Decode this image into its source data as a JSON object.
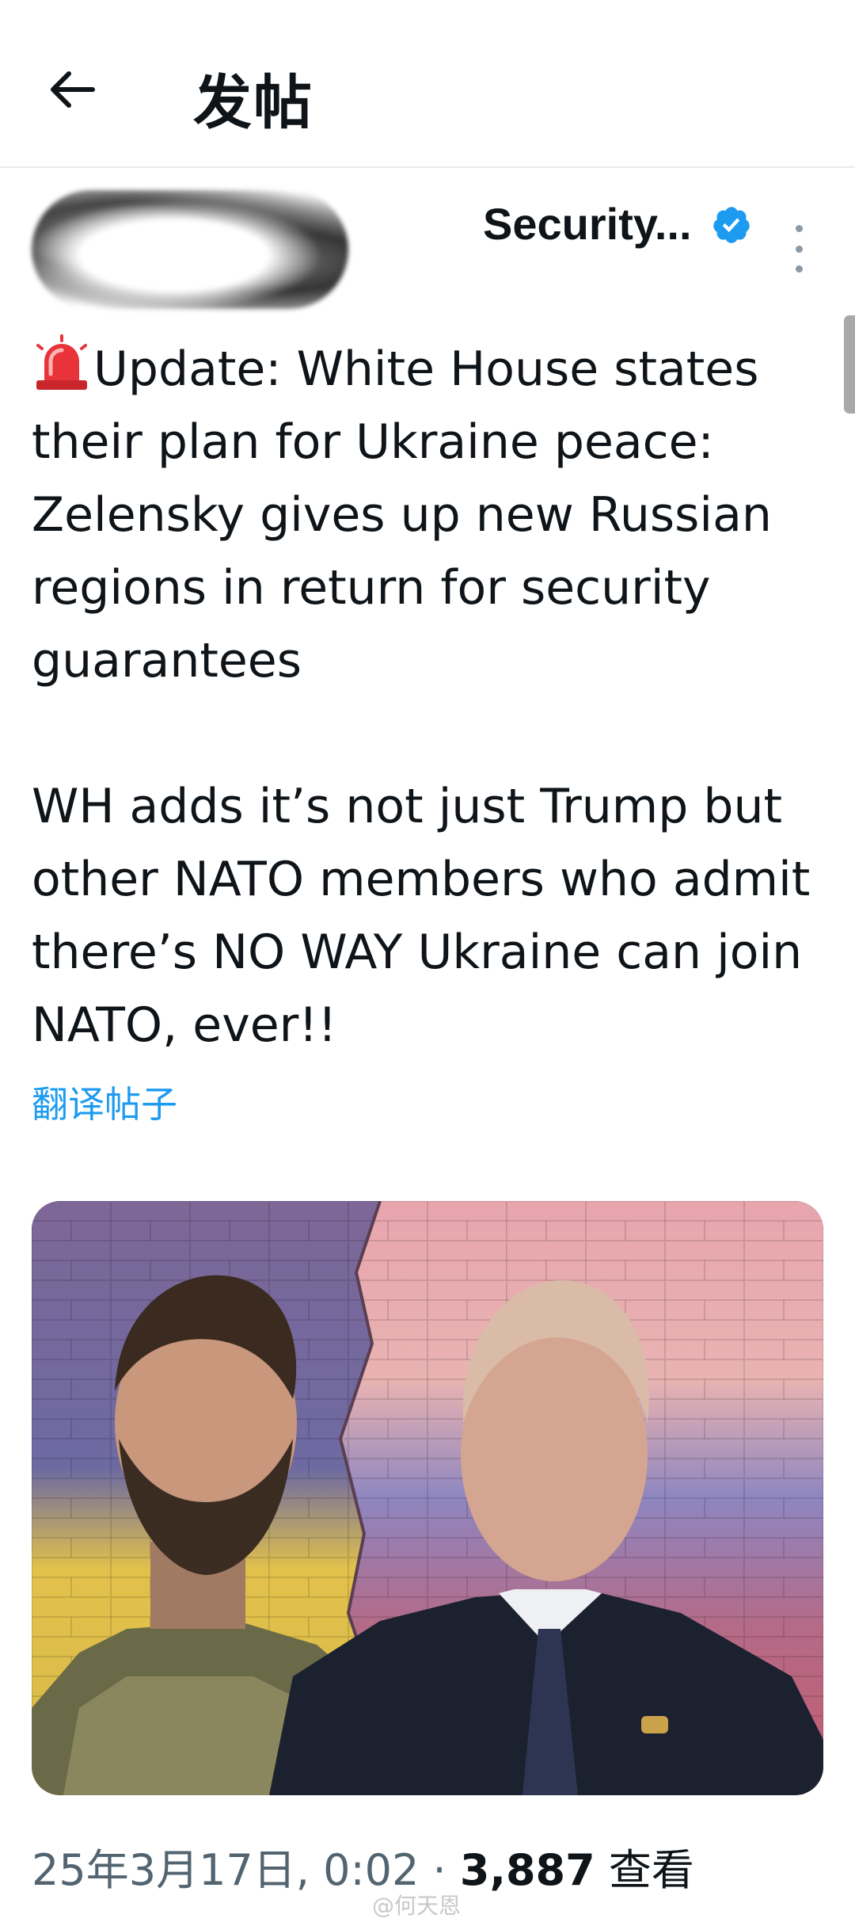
{
  "header": {
    "title": "发帖",
    "back_icon": "arrow-left-icon"
  },
  "author": {
    "name_visible": "Security...",
    "verified_color": "#1d9bf0"
  },
  "tweet": {
    "text": "Update: White House states their plan for Ukraine peace: Zelensky gives up new Russian regions in return for security guarantees\n\nWH adds it’s not just Trump but other NATO members who admit there’s NO WAY Ukraine can join NATO, ever!!",
    "translate_label": "翻译帖子"
  },
  "meta": {
    "timestamp": "25年3月17日, 0:02",
    "separator": " · ",
    "views_count": "3,887",
    "views_label": " 查看"
  },
  "watermark": "@何天恩",
  "colors": {
    "accent": "#1d9bf0",
    "secondary_text": "#536471",
    "divider": "#e6ecf0"
  }
}
